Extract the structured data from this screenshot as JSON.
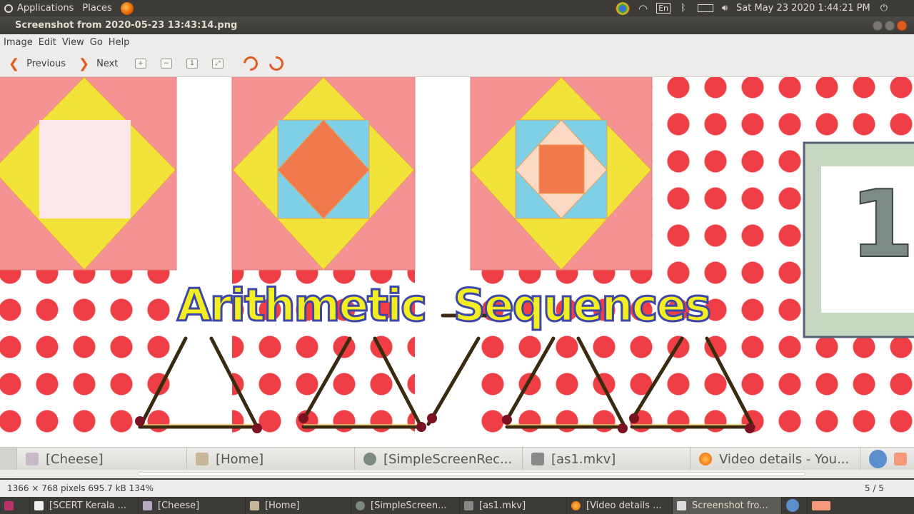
{
  "topbar": {
    "applications": "Applications",
    "places": "Places",
    "keyboard": "En",
    "datetime": "Sat May 23 2020  1:44:21 PM"
  },
  "window": {
    "title": "Screenshot from 2020-05-23 13:43:14.png"
  },
  "menu": [
    "Image",
    "Edit",
    "View",
    "Go",
    "Help"
  ],
  "toolbar": {
    "previous": "Previous",
    "next": "Next"
  },
  "image": {
    "title_text": "Arithmetic  Sequences",
    "badge_text": "1"
  },
  "inner_taskbar": [
    {
      "label": "[Cheese]"
    },
    {
      "label": "[Home]"
    },
    {
      "label": "[SimpleScreenRec..."
    },
    {
      "label": "[as1.mkv]"
    },
    {
      "label": "Video details - You..."
    }
  ],
  "status": {
    "info": "1366 × 768 pixels  695.7 kB   134%",
    "page": "5 / 5"
  },
  "taskbar": [
    {
      "label": "[SCERT Kerala ..."
    },
    {
      "label": "[Cheese]"
    },
    {
      "label": "[Home]"
    },
    {
      "label": "[SimpleScreen..."
    },
    {
      "label": "[as1.mkv]"
    },
    {
      "label": "[Video details ..."
    },
    {
      "label": "Screenshot fro...",
      "active": true
    }
  ],
  "colors": {
    "accent": "#e05b1d",
    "dot_red": "#ef3e45",
    "yellow": "#f1e33a",
    "sky": "#7fd0e6"
  }
}
